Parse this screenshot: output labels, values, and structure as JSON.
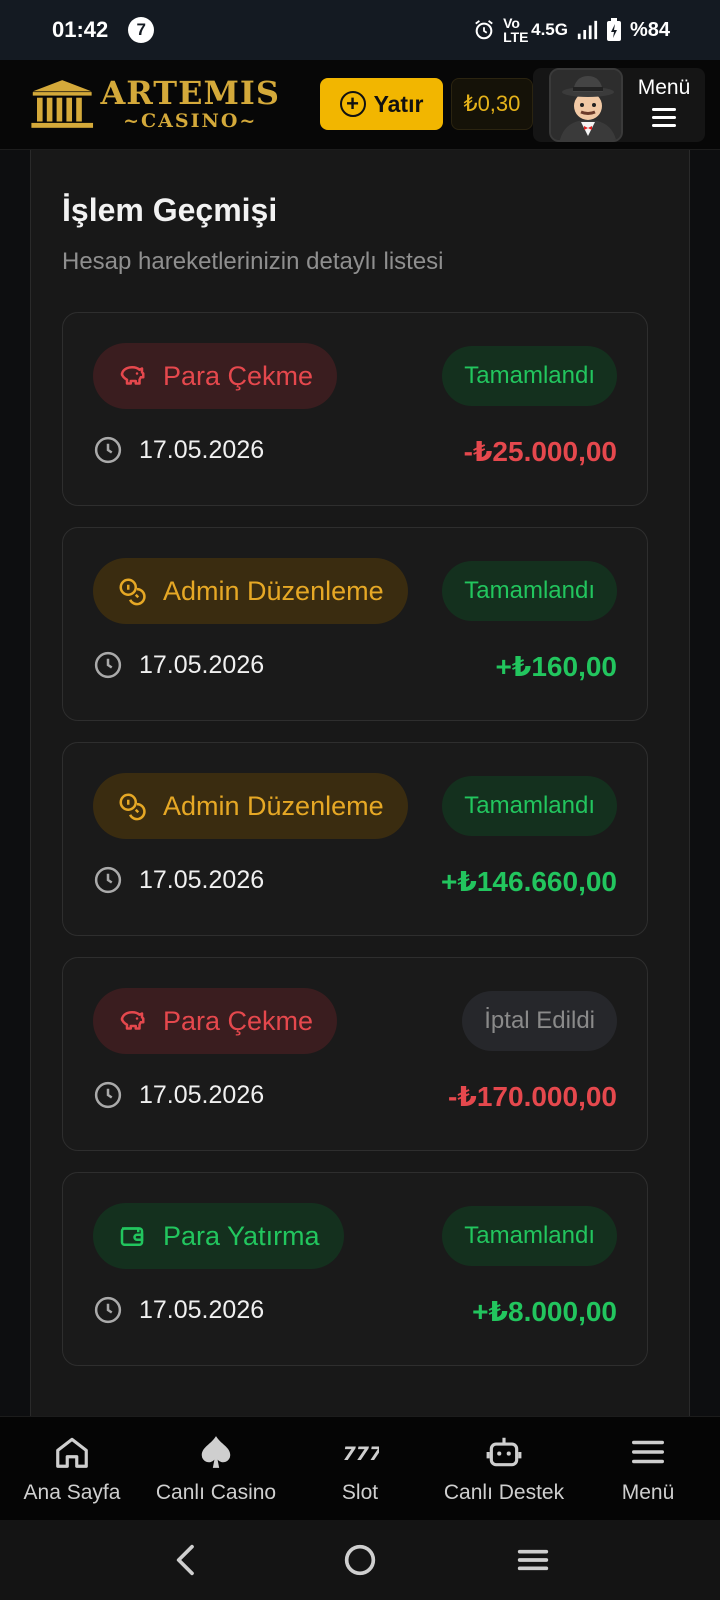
{
  "status_bar": {
    "time": "01:42",
    "notification_count": "7",
    "network": "4.5G",
    "volte": "Vo LTE",
    "battery": "%84"
  },
  "header": {
    "logo_title": "ARTEMIS",
    "logo_sub": "CASINO",
    "deposit_label": "Yatır",
    "balance": "₺0,30",
    "menu_label": "Menü"
  },
  "page": {
    "title": "İşlem Geçmişi",
    "subtitle": "Hesap hareketlerinizin detaylı listesi"
  },
  "transactions": [
    {
      "type": "Para Çekme",
      "icon": "piggy-bank-icon",
      "status": "Tamamlandı",
      "date": "17.05.2026",
      "amount": "-₺25.000,00"
    },
    {
      "type": "Admin Düzenleme",
      "icon": "coins-icon",
      "status": "Tamamlandı",
      "date": "17.05.2026",
      "amount": "+₺160,00"
    },
    {
      "type": "Admin Düzenleme",
      "icon": "coins-icon",
      "status": "Tamamlandı",
      "date": "17.05.2026",
      "amount": "+₺146.660,00"
    },
    {
      "type": "Para Çekme",
      "icon": "piggy-bank-icon",
      "status": "İptal Edildi",
      "date": "17.05.2026",
      "amount": "-₺170.000,00"
    },
    {
      "type": "Para Yatırma",
      "icon": "wallet-icon",
      "status": "Tamamlandı",
      "date": "17.05.2026",
      "amount": "+₺8.000,00"
    }
  ],
  "bottom_nav": {
    "home": "Ana Sayfa",
    "live_casino": "Canlı Casino",
    "slot": "Slot",
    "live_support": "Canlı Destek",
    "menu": "Menü"
  },
  "colors": {
    "accent": "#f2b600",
    "withdraw": "#e5484d",
    "admin": "#e6a825",
    "deposit": "#22c55e",
    "cancelled": "#8a8a8a"
  }
}
